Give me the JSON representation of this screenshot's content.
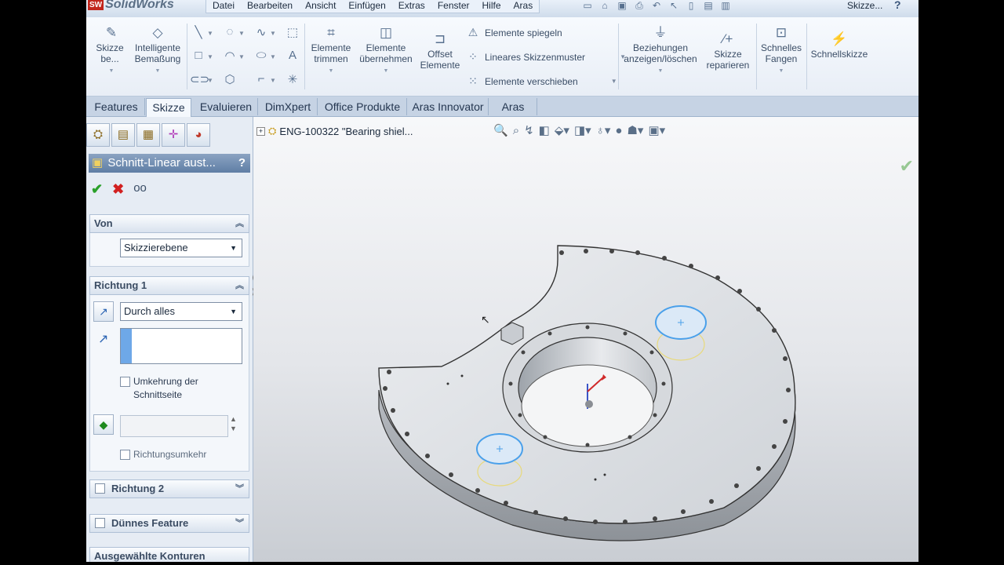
{
  "app": {
    "logo_badge": "SW",
    "logo_text": "SolidWorks",
    "menu": [
      "Datei",
      "Bearbeiten",
      "Ansicht",
      "Einfügen",
      "Extras",
      "Fenster",
      "Hilfe",
      "Aras"
    ],
    "doc_title": "Skizze...",
    "help": "?"
  },
  "ribbon": {
    "sketch": "Skizze be...",
    "smart_dim": [
      "Intelligente",
      "Bemaßung"
    ],
    "trim": [
      "Elemente",
      "trimmen"
    ],
    "convert": [
      "Elemente",
      "übernehmen"
    ],
    "offset": [
      "Offset",
      "Elemente"
    ],
    "mirror": "Elemente spiegeln",
    "pattern": "Lineares Skizzenmuster",
    "move": "Elemente verschieben",
    "relations": [
      "Beziehungen",
      "anzeigen/löschen"
    ],
    "repair": [
      "Skizze",
      "reparieren"
    ],
    "snap": [
      "Schnelles",
      "Fangen"
    ],
    "rapid": "Schnellskizze"
  },
  "tabs": [
    "Features",
    "Skizze",
    "Evaluieren",
    "DimXpert",
    "Office Produkte",
    "Aras Innovator",
    "Aras"
  ],
  "active_tab": "Skizze",
  "panel": {
    "title": "Schnitt-Linear aust...",
    "help": "?",
    "von": {
      "header": "Von",
      "value": "Skizzierebene"
    },
    "richtung1": {
      "header": "Richtung 1",
      "value": "Durch alles",
      "flip_label": [
        "Umkehrung der",
        "Schnittseite"
      ],
      "draft_label": "Richtungsumkehr"
    },
    "richtung2": "Richtung 2",
    "duennes": "Dünnes Feature",
    "konturen": "Ausgewählte Konturen"
  },
  "viewport": {
    "tree_label": "ENG-100322 \"Bearing shiel..."
  }
}
